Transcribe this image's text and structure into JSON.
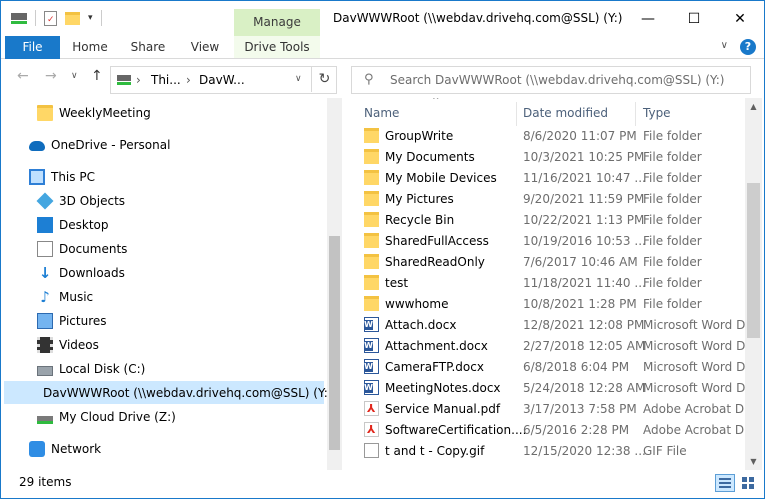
{
  "window": {
    "title": "DavWWWRoot (\\\\webdav.drivehq.com@SSL) (Y:)",
    "contextual_tab": "Manage",
    "controls": {
      "minimize": "—",
      "maximize": "☐",
      "close": "✕"
    }
  },
  "ribbon": {
    "tabs": [
      "File",
      "Home",
      "Share",
      "View",
      "Drive Tools"
    ],
    "expand_icon": "chevron-down",
    "help_glyph": "?"
  },
  "address": {
    "back_glyph": "←",
    "forward_glyph": "→",
    "recent_glyph": "∨",
    "up_glyph": "↑",
    "segments": [
      "Thi...",
      "DavW..."
    ],
    "separator": "›",
    "refresh_glyph": "↻",
    "search_placeholder": "Search DavWWWRoot (\\\\webdav.drivehq.com@SSL) (Y:)"
  },
  "nav_pane": {
    "items": [
      {
        "label": "WeeklyMeeting",
        "icon": "folder"
      },
      {
        "label": "OneDrive - Personal",
        "icon": "onedrive"
      },
      {
        "label": "This PC",
        "icon": "pc"
      },
      {
        "label": "3D Objects",
        "icon": "3d"
      },
      {
        "label": "Desktop",
        "icon": "desktop"
      },
      {
        "label": "Documents",
        "icon": "documents"
      },
      {
        "label": "Downloads",
        "icon": "downloads"
      },
      {
        "label": "Music",
        "icon": "music"
      },
      {
        "label": "Pictures",
        "icon": "pictures"
      },
      {
        "label": "Videos",
        "icon": "videos"
      },
      {
        "label": "Local Disk (C:)",
        "icon": "disk"
      },
      {
        "label": "DavWWWRoot (\\\\webdav.drivehq.com@SSL) (Y:)",
        "icon": "network-drive",
        "selected": true
      },
      {
        "label": "My Cloud Drive (Z:)",
        "icon": "network-drive"
      },
      {
        "label": "Network",
        "icon": "network"
      }
    ]
  },
  "file_list": {
    "columns": [
      "Name",
      "Date modified",
      "Type"
    ],
    "sort_glyph": "^",
    "rows": [
      {
        "name": "GroupWrite",
        "date": "8/6/2020 11:07 PM",
        "type": "File folder",
        "icon": "folder"
      },
      {
        "name": "My Documents",
        "date": "10/3/2021 10:25 PM",
        "type": "File folder",
        "icon": "folder"
      },
      {
        "name": "My Mobile Devices",
        "date": "11/16/2021 10:47 ...",
        "type": "File folder",
        "icon": "folder"
      },
      {
        "name": "My Pictures",
        "date": "9/20/2021 11:59 PM",
        "type": "File folder",
        "icon": "folder"
      },
      {
        "name": "Recycle Bin",
        "date": "10/22/2021 1:13 PM",
        "type": "File folder",
        "icon": "folder"
      },
      {
        "name": "SharedFullAccess",
        "date": "10/19/2016 10:53 ...",
        "type": "File folder",
        "icon": "folder"
      },
      {
        "name": "SharedReadOnly",
        "date": "7/6/2017 10:46 AM",
        "type": "File folder",
        "icon": "folder"
      },
      {
        "name": "test",
        "date": "11/18/2021 11:40 ...",
        "type": "File folder",
        "icon": "folder"
      },
      {
        "name": "wwwhome",
        "date": "10/8/2021 1:28 PM",
        "type": "File folder",
        "icon": "folder"
      },
      {
        "name": "Attach.docx",
        "date": "12/8/2021 12:08 PM",
        "type": "Microsoft Word D...",
        "icon": "word"
      },
      {
        "name": "Attachment.docx",
        "date": "2/27/2018 12:05 AM",
        "type": "Microsoft Word D...",
        "icon": "word"
      },
      {
        "name": "CameraFTP.docx",
        "date": "6/8/2018 6:04 PM",
        "type": "Microsoft Word D...",
        "icon": "word"
      },
      {
        "name": "MeetingNotes.docx",
        "date": "5/24/2018 12:28 AM",
        "type": "Microsoft Word D...",
        "icon": "word"
      },
      {
        "name": "Service Manual.pdf",
        "date": "3/17/2013 7:58 PM",
        "type": "Adobe Acrobat D...",
        "icon": "pdf"
      },
      {
        "name": "SoftwareCertification....",
        "date": "6/5/2016 2:28 PM",
        "type": "Adobe Acrobat D...",
        "icon": "pdf"
      },
      {
        "name": "t and t - Copy.gif",
        "date": "12/15/2020 12:38 ...",
        "type": "GIF File",
        "icon": "gif"
      }
    ]
  },
  "status": {
    "item_count": "29 items"
  },
  "colors": {
    "accent": "#1979ca",
    "manage_tab": "#d9f0c5",
    "selection": "#cce8ff"
  }
}
